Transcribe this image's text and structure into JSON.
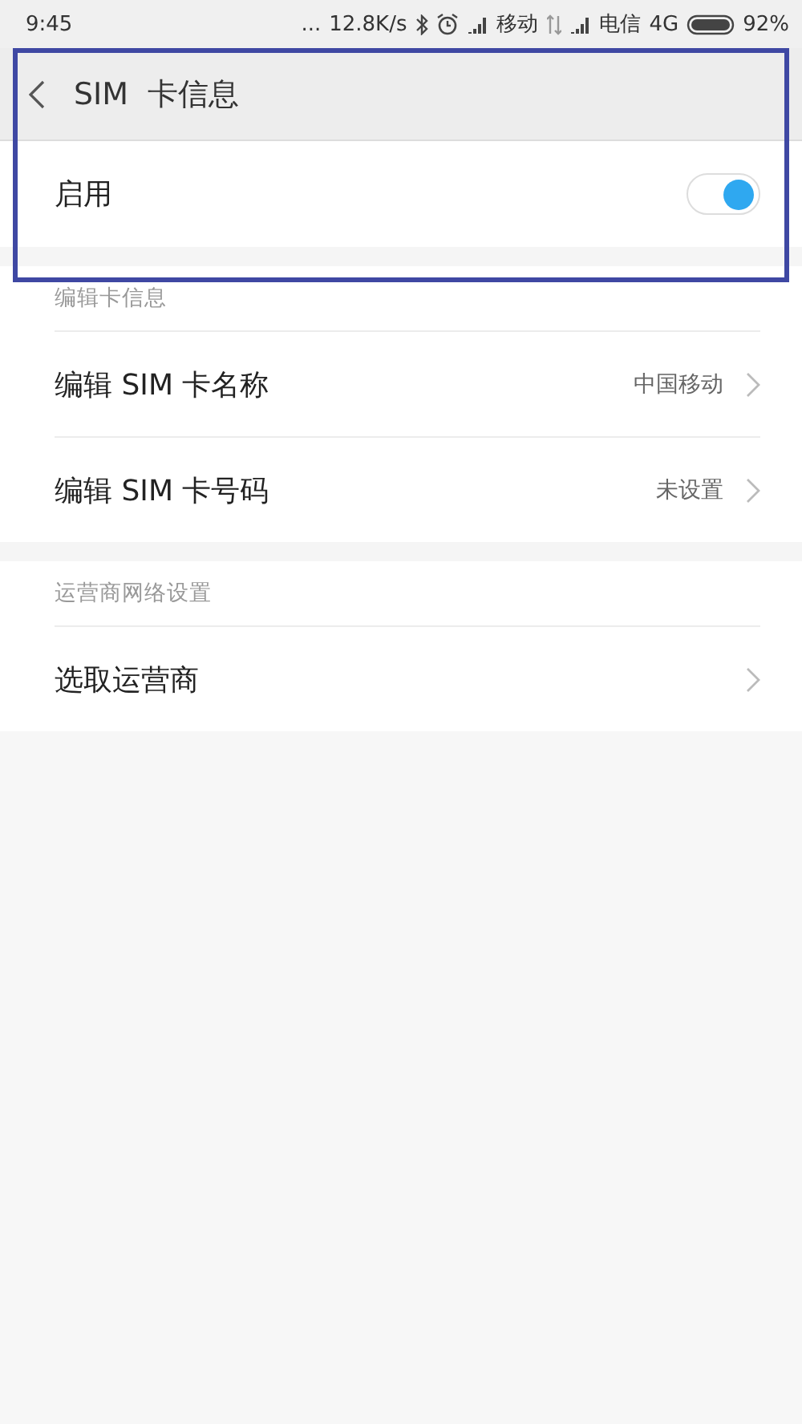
{
  "status_bar": {
    "time": "9:45",
    "dots": "...",
    "speed": "12.8K/s",
    "carrier_1": "移动",
    "carrier_2": "电信",
    "network": "4G",
    "battery": "92%"
  },
  "header": {
    "title": "SIM  卡信息"
  },
  "enable_row": {
    "label": "启用",
    "on": true
  },
  "sections": [
    {
      "title": "编辑卡信息",
      "rows": [
        {
          "label": "编辑 SIM 卡名称",
          "value": "中国移动"
        },
        {
          "label": "编辑 SIM 卡号码",
          "value": "未设置"
        }
      ]
    },
    {
      "title": "运营商网络设置",
      "rows": [
        {
          "label": "选取运营商"
        }
      ]
    }
  ],
  "highlight": {
    "shown": true
  }
}
